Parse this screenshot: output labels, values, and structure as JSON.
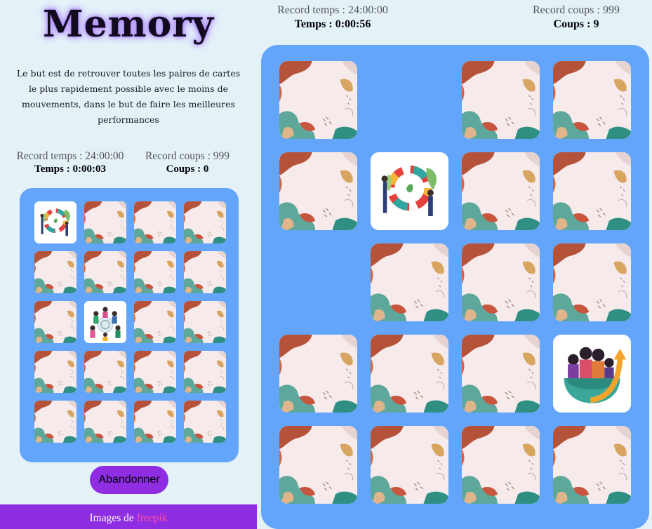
{
  "left": {
    "title": "Memory",
    "description": "Le but est de retrouver toutes les paires de cartes le plus rapidement possible avec le moins de mouvements, dans le but de faire les meilleures performances",
    "stats": {
      "record_time": "Record temps : 24:00:00",
      "record_moves": "Record coups : 999",
      "time": "Temps : 0:00:03",
      "moves": "Coups : 0"
    },
    "cards": [
      "face-puzzle",
      "back",
      "back",
      "back",
      "back",
      "back",
      "back",
      "back",
      "back",
      "face-community",
      "back",
      "back",
      "back",
      "back",
      "back",
      "back",
      "back",
      "back",
      "back",
      "back"
    ],
    "abandon_label": "Abandonner",
    "footer_prefix": "Images de ",
    "footer_link": "freepik"
  },
  "right": {
    "stats": {
      "record_time": "Record temps : 24:00:00",
      "record_moves": "Record coups : 999",
      "time": "Temps : 0:00:56",
      "moves": "Coups : 9"
    },
    "cards": [
      "back",
      "empty",
      "back",
      "back",
      "back",
      "face-puzzle",
      "back",
      "back",
      "empty",
      "back",
      "back",
      "back",
      "back",
      "back",
      "back",
      "face-growth",
      "back",
      "back",
      "back",
      "back"
    ]
  },
  "colors": {
    "background": "#e4f2f8",
    "board": "#63a5fa",
    "accent": "#8e2de2",
    "footer_link": "#ff4fa5",
    "card_back": "#f5e9e9"
  }
}
